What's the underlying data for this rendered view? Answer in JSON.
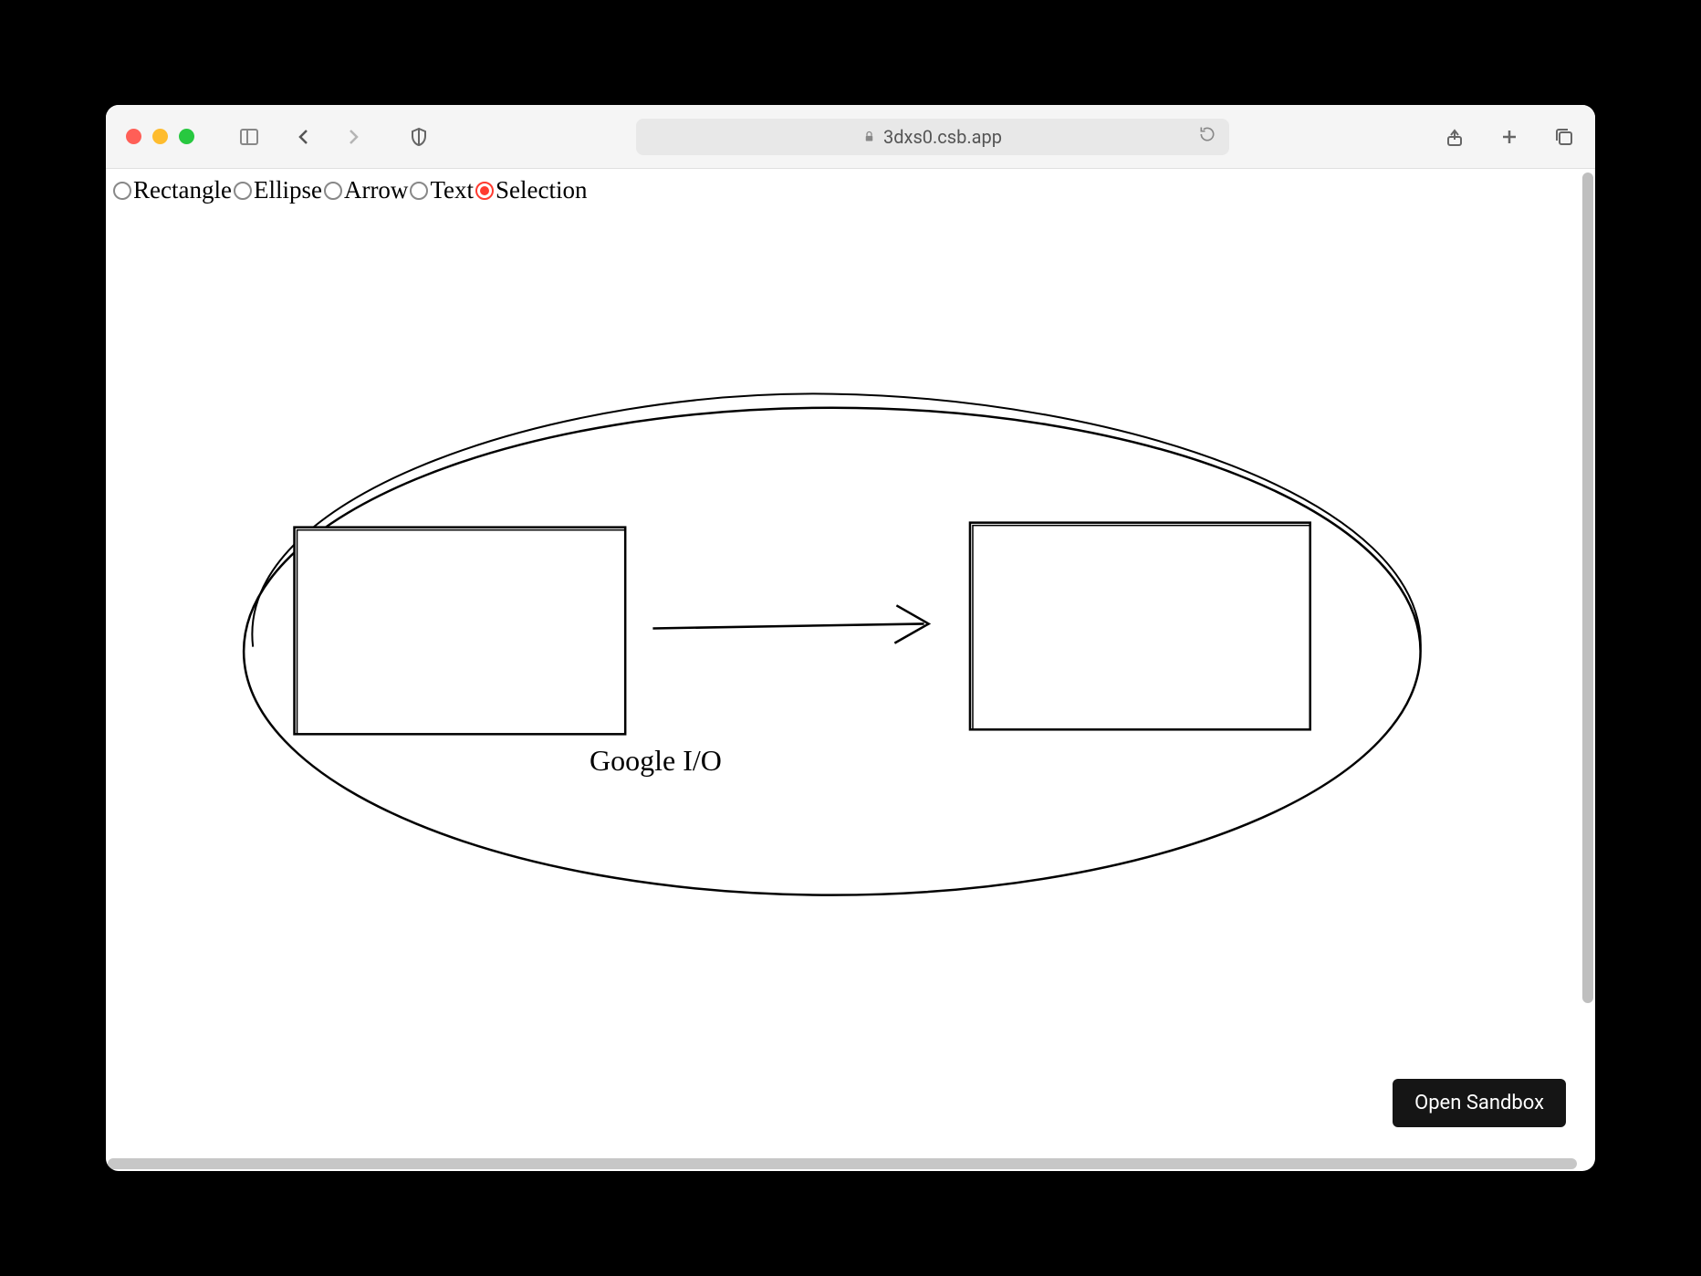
{
  "browser": {
    "url": "3dxs0.csb.app"
  },
  "toolbar": {
    "options": [
      {
        "id": "rectangle",
        "label": "Rectangle",
        "checked": false
      },
      {
        "id": "ellipse",
        "label": "Ellipse",
        "checked": false
      },
      {
        "id": "arrow",
        "label": "Arrow",
        "checked": false
      },
      {
        "id": "text",
        "label": "Text",
        "checked": false
      },
      {
        "id": "selection",
        "label": "Selection",
        "checked": true
      }
    ]
  },
  "canvas": {
    "text_label": "Google I/O"
  },
  "buttons": {
    "open_sandbox": "Open Sandbox"
  }
}
